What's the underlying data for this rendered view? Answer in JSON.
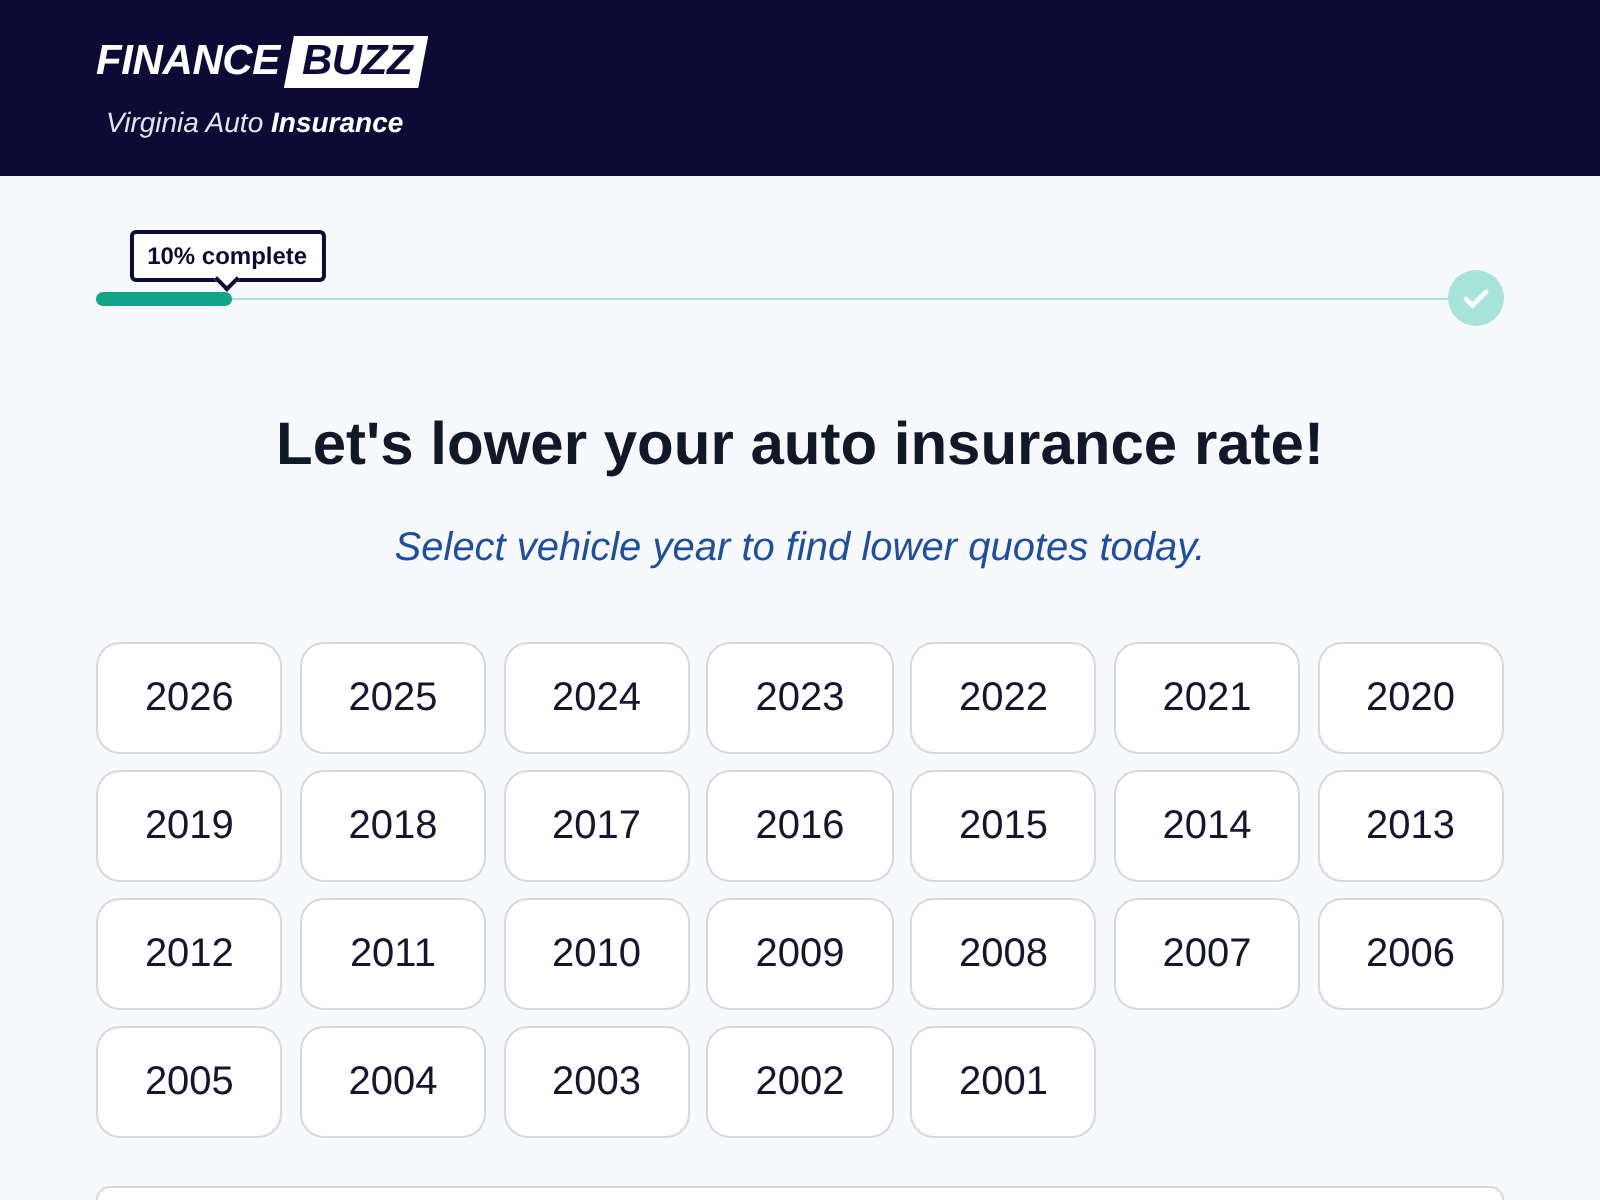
{
  "header": {
    "logo": {
      "wordmark": "FINANCE",
      "badge": "BUZZ"
    },
    "subtitle": "Virginia Auto **Insurance**"
  },
  "progress": {
    "label": "10% complete",
    "level": 0.1
  },
  "heading": {
    "title": "Let's lower your auto insurance rate!",
    "subtitle": "Select vehicle year to find lower quotes today."
  },
  "years": [
    {
      "label": "2026",
      "selected": false
    },
    {
      "label": "2025",
      "selected": false
    },
    {
      "label": "2024",
      "selected": false
    },
    {
      "label": "2023",
      "selected": false
    },
    {
      "label": "2022",
      "selected": false
    },
    {
      "label": "2021",
      "selected": false
    },
    {
      "label": "2020",
      "selected": false
    },
    {
      "label": "2019",
      "selected": false
    },
    {
      "label": "2018",
      "selected": false
    },
    {
      "label": "2017",
      "selected": false
    },
    {
      "label": "2016",
      "selected": false
    },
    {
      "label": "2015",
      "selected": false
    },
    {
      "label": "2014",
      "selected": false
    },
    {
      "label": "2013",
      "selected": false
    },
    {
      "label": "2012",
      "selected": false
    },
    {
      "label": "2011",
      "selected": false
    },
    {
      "label": "2010",
      "selected": false
    },
    {
      "label": "2009",
      "selected": false
    },
    {
      "label": "2008",
      "selected": false
    },
    {
      "label": "2007",
      "selected": false
    },
    {
      "label": "2006",
      "selected": false
    },
    {
      "label": "2005",
      "selected": false
    },
    {
      "label": "2004",
      "selected": false
    },
    {
      "label": "2003",
      "selected": false
    },
    {
      "label": "2002",
      "selected": false
    },
    {
      "label": "2001",
      "selected": false
    }
  ]
}
